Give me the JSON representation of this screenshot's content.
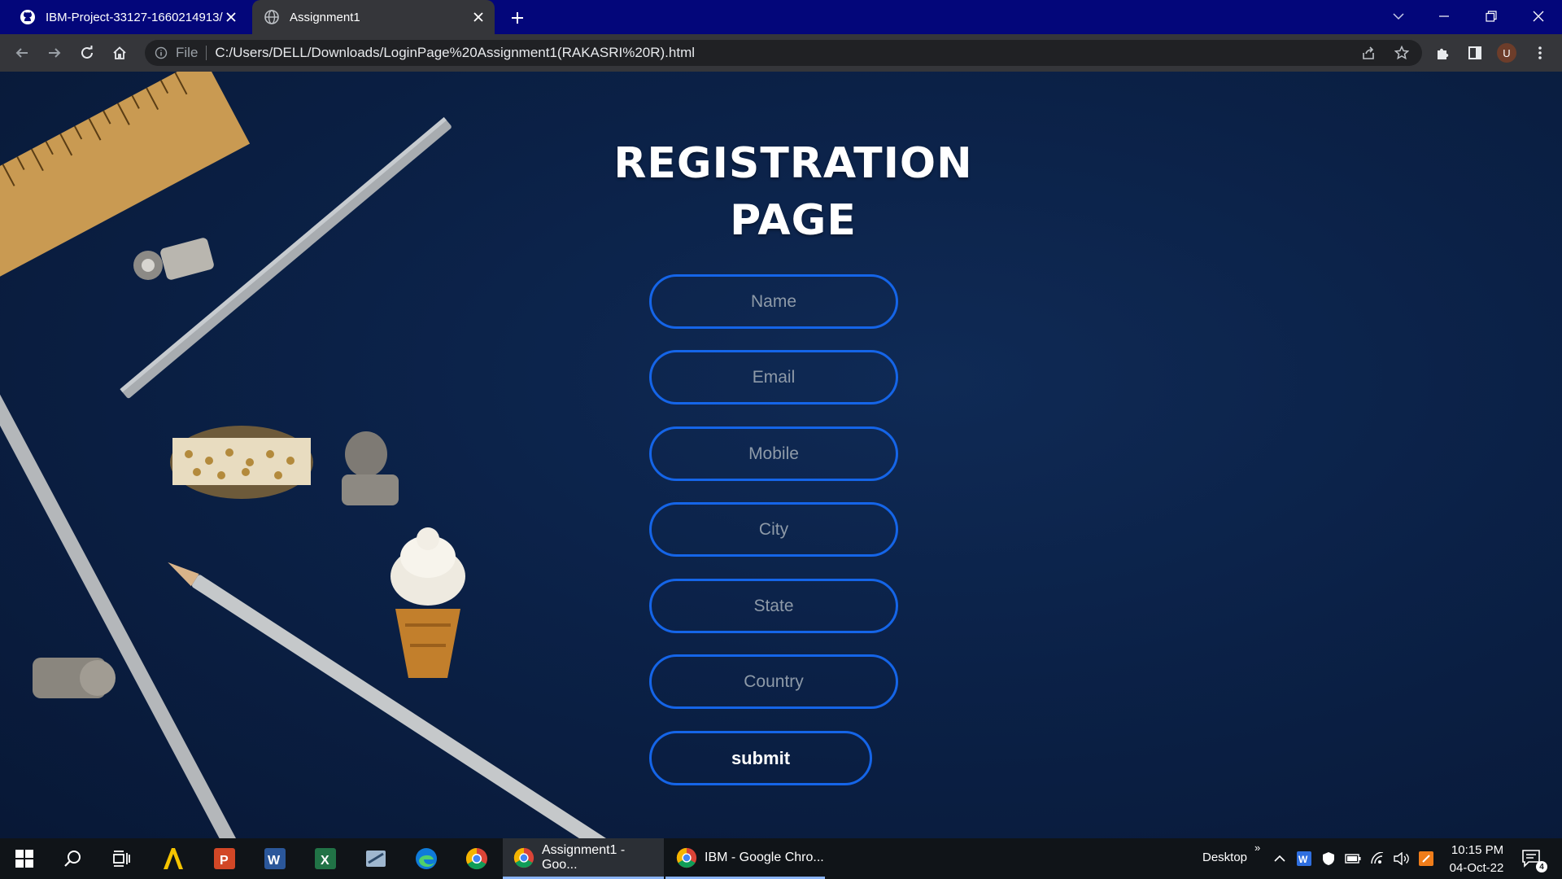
{
  "browser": {
    "tabs": [
      {
        "label": "IBM-Project-33127-1660214913/",
        "active": false
      },
      {
        "label": "Assignment1",
        "active": true
      }
    ],
    "omnibox": {
      "scheme_label": "File",
      "url": "C:/Users/DELL/Downloads/LoginPage%20Assignment1(RAKASRI%20R).html"
    },
    "profile_initial": "U"
  },
  "page": {
    "title_line1": "REGISTRATION",
    "title_line2": "PAGE",
    "fields": {
      "name": "Name",
      "email": "Email",
      "mobile": "Mobile",
      "city": "City",
      "state": "State",
      "country": "Country"
    },
    "submit_label": "submit",
    "colors": {
      "field_border": "#1565e8",
      "background": "#0b2147",
      "text": "#ffffff"
    }
  },
  "taskbar": {
    "apps": [
      {
        "label": "Assignment1 - Goo...",
        "active": true
      },
      {
        "label": "IBM - Google Chro...",
        "active": false
      }
    ],
    "desktop_label": "Desktop",
    "time": "10:15 PM",
    "date": "04-Oct-22",
    "notification_count": "4"
  }
}
